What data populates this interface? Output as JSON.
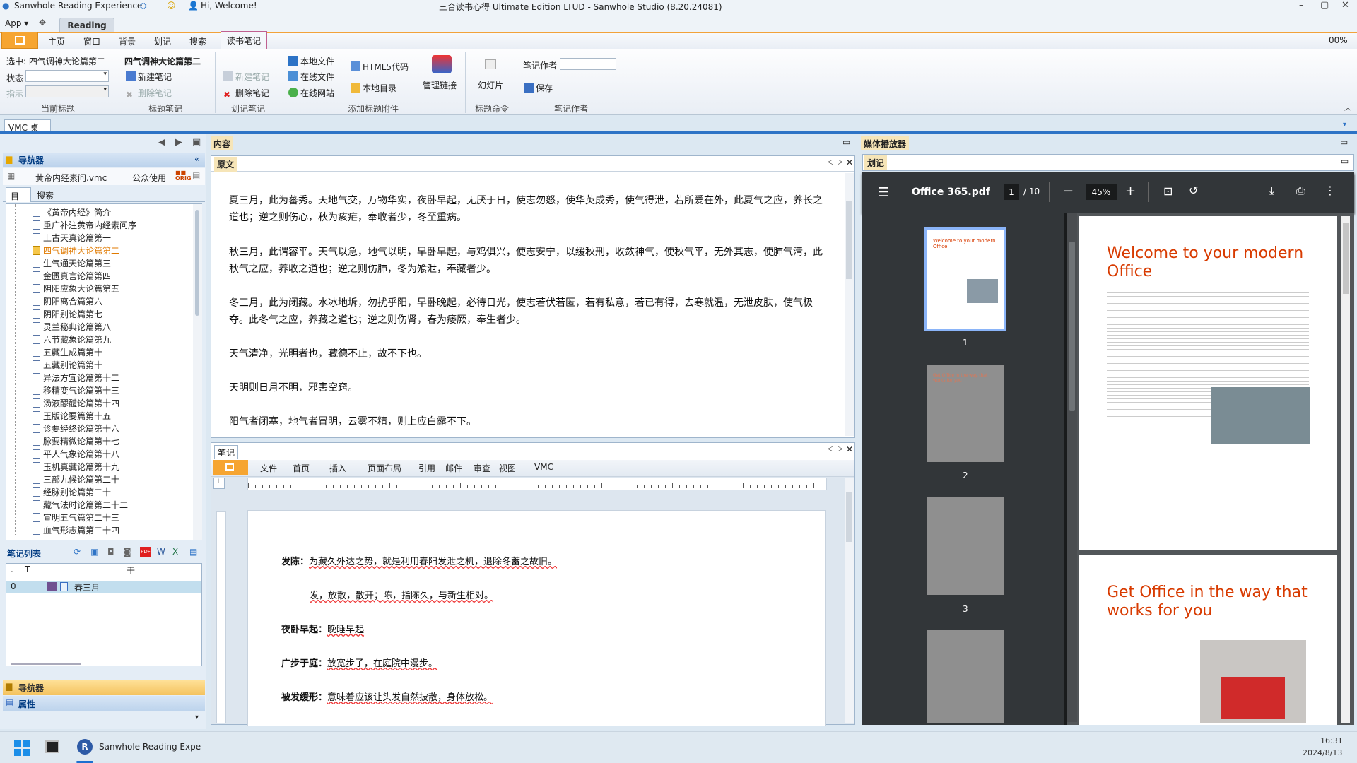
{
  "window": {
    "app_title": "Sanwhole Reading Experience",
    "welcome": "Hi, Welcome!",
    "title": "三合读书心得 Ultimate Edition LTUD - Sanwhole Studio (8.20.24081)"
  },
  "app_row": {
    "app_menu": "App",
    "reading_tab": "Reading"
  },
  "menu": {
    "items": [
      "主页",
      "窗口",
      "背景",
      "划记",
      "搜索"
    ],
    "active": "读书笔记",
    "zoom": "00%"
  },
  "ribbon": {
    "current": {
      "selected_label": "选中: 四气调神大论篇第二",
      "status_label": "状态",
      "indicator_label": "指示",
      "group": "当前标题"
    },
    "title_note": {
      "heading": "四气调神大论篇第二",
      "new": "新建笔记",
      "delete": "删除笔记",
      "group": "标题笔记"
    },
    "mark_note": {
      "new": "新建笔记",
      "delete": "删除笔记",
      "group": "划记笔记"
    },
    "attach": {
      "local": "本地文件",
      "online": "在线文件",
      "site": "在线网站",
      "html5": "HTML5代码",
      "local_dir": "本地目录",
      "manage": "管理链接",
      "group": "添加标题附件"
    },
    "slides": {
      "label": "幻灯片",
      "group": "标题命令"
    },
    "author": {
      "label": "笔记作者",
      "save": "保存",
      "group": "笔记作者"
    }
  },
  "desktop_tab": "VMC 桌面",
  "navigator": {
    "title": "导航器",
    "file": "黄帝内经素问.vmc",
    "public": "公众使用",
    "tabs": [
      "目录",
      "搜索"
    ],
    "items": [
      "《黄帝内经》简介",
      "重广补注黄帝内经素问序",
      "上古天真论篇第一",
      "四气调神大论篇第二",
      "生气通天论篇第三",
      "金匮真言论篇第四",
      "阴阳应象大论篇第五",
      "阴阳离合篇第六",
      "阴阳别论篇第七",
      "灵兰秘典论篇第八",
      "六节藏象论篇第九",
      "五藏生成篇第十",
      "五藏别论篇第十一",
      "异法方宜论篇第十二",
      "移精变气论篇第十三",
      "汤液醪醴论篇第十四",
      "玉版论要篇第十五",
      "诊要经终论篇第十六",
      "脉要精微论篇第十七",
      "平人气象论篇第十八",
      "玉机真藏论篇第十九",
      "三部九候论篇第二十",
      "经脉别论篇第二十一",
      "藏气法时论篇第二十二",
      "宣明五气篇第二十三",
      "血气形志篇第二十四"
    ],
    "selected_index": 3
  },
  "notes_list": {
    "title": "笔记列表",
    "col_dot": ".",
    "col_t": "T",
    "col_title": "于",
    "row_index": "0",
    "row_title": "春三月"
  },
  "bottom_nav": {
    "navigator": "导航器",
    "properties": "属性"
  },
  "content": {
    "header": "内容",
    "tab": "原文",
    "paragraphs": [
      "夏三月，此为蕃秀。天地气交，万物华实，夜卧早起，无厌于日，使志勿怒，使华英成秀，使气得泄，若所爱在外，此夏气之应，养长之道也；逆之则伤心，秋为痎疟，奉收者少，冬至重病。",
      "秋三月，此谓容平。天气以急，地气以明，早卧早起，与鸡俱兴，使志安宁，以缓秋刑，收敛神气，使秋气平，无外其志，使肺气清，此秋气之应，养收之道也；逆之则伤肺，冬为飧泄，奉藏者少。",
      "冬三月，此为闭藏。水冰地坼，勿扰乎阳，早卧晚起，必待日光，使志若伏若匿，若有私意，若已有得，去寒就温，无泄皮肤，使气极夺。此冬气之应，养藏之道也；逆之则伤肾，春为痿厥，奉生者少。",
      "天气清净，光明者也，藏德不止，故不下也。",
      "天明则日月不明，邪害空窍。",
      "阳气者闭塞，地气者冒明，云雾不精，则上应白露不下。"
    ]
  },
  "notes": {
    "tab": "笔记",
    "menu": [
      "文件",
      "首页",
      "插入",
      "页面布局",
      "引用",
      "邮件",
      "审查",
      "视图",
      "VMC"
    ],
    "lines": [
      {
        "term": "发陈：",
        "text": "为藏久外达之势，就是利用春阳发泄之机，退除冬蓄之故旧。"
      },
      {
        "term": "",
        "text": "发，放散，散开；陈，指陈久，与新生相对。"
      },
      {
        "term": "夜卧早起：",
        "text": "晚睡早起"
      },
      {
        "term": "广步于庭：",
        "text": "放宽步子，在庭院中漫步。"
      },
      {
        "term": "被发缓形：",
        "text": "意味着应该让头发自然披散，身体放松。"
      }
    ]
  },
  "media": {
    "header": "媒体播放器",
    "tab": "划记",
    "pdf_name": "Office 365.pdf",
    "page": "1",
    "pages": "/ 10",
    "zoom": "45%",
    "thumbs": [
      "1",
      "2",
      "3"
    ],
    "page1_title": "Welcome to your modern Office",
    "page2_title": "Get Office in the way that works for you"
  },
  "taskbar": {
    "app": "Sanwhole Reading Expe",
    "time": "16:31",
    "date": "2024/8/13"
  },
  "colors": {
    "accent": "#2d73c6",
    "orange": "#f2a23a",
    "pdf_bg": "#323639",
    "office_red": "#d83b01"
  }
}
